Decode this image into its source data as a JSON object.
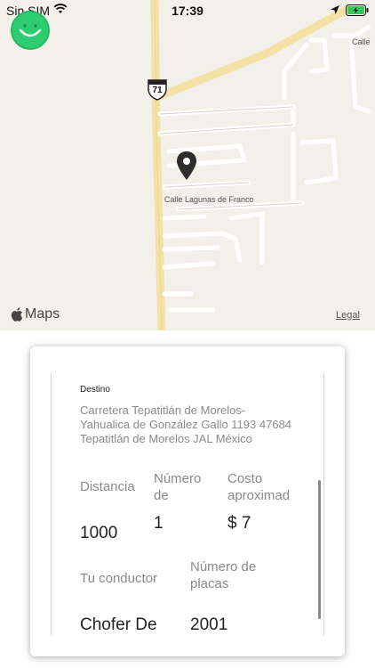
{
  "status_bar": {
    "carrier": "Sin SIM",
    "time": "17:39"
  },
  "map": {
    "highway_shield": "71",
    "street_label": "Calle Lagunas de Franco",
    "street_label_top_right": "Calle",
    "brand": "Maps",
    "legal": "Legal"
  },
  "trip": {
    "destination_title": "Destino",
    "destination_address": "Carretera Tepatitlán de Morelos-Yahualica de González Gallo 1193 47684 Tepatitlán de Morelos JAL México",
    "distance_label": "Distancia",
    "distance_value": "1000",
    "number_label": "Número de",
    "number_value": "1",
    "cost_label": "Costo aproximad",
    "cost_value": "$ 7",
    "driver_label": "Tu conductor",
    "driver_value": "Chofer De",
    "plates_label": "Número de placas",
    "plates_value": "2001"
  }
}
